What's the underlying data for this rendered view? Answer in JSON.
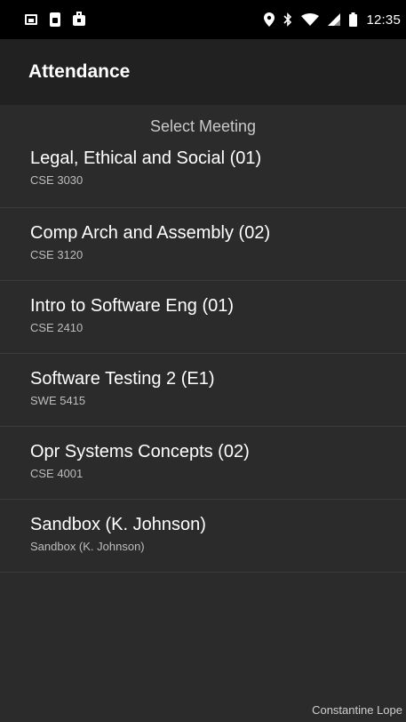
{
  "status_bar": {
    "left_icons": [
      "image-icon",
      "phone-doc-icon",
      "bag-icon"
    ],
    "right_icons": [
      "location-pin-icon",
      "bluetooth-icon",
      "wifi-icon",
      "signal-icon",
      "battery-icon"
    ],
    "time": "12:35"
  },
  "app_bar": {
    "title": "Attendance"
  },
  "main": {
    "section_header": "Select Meeting",
    "meetings": [
      {
        "name": "Legal, Ethical and Social (01)",
        "code": "CSE 3030"
      },
      {
        "name": "Comp Arch and Assembly (02)",
        "code": "CSE 3120"
      },
      {
        "name": "Intro to Software Eng (01)",
        "code": "CSE 2410"
      },
      {
        "name": "Software Testing 2 (E1)",
        "code": "SWE 5415"
      },
      {
        "name": "Opr Systems Concepts (02)",
        "code": "CSE 4001"
      },
      {
        "name": "Sandbox (K. Johnson)",
        "code": "Sandbox (K. Johnson)"
      }
    ]
  },
  "footer": {
    "user_name": "Constantine Lope"
  },
  "colors": {
    "status_bar_bg": "#000000",
    "app_bar_bg": "#212121",
    "content_bg": "#2b2b2b",
    "divider": "#3c3c3c"
  }
}
